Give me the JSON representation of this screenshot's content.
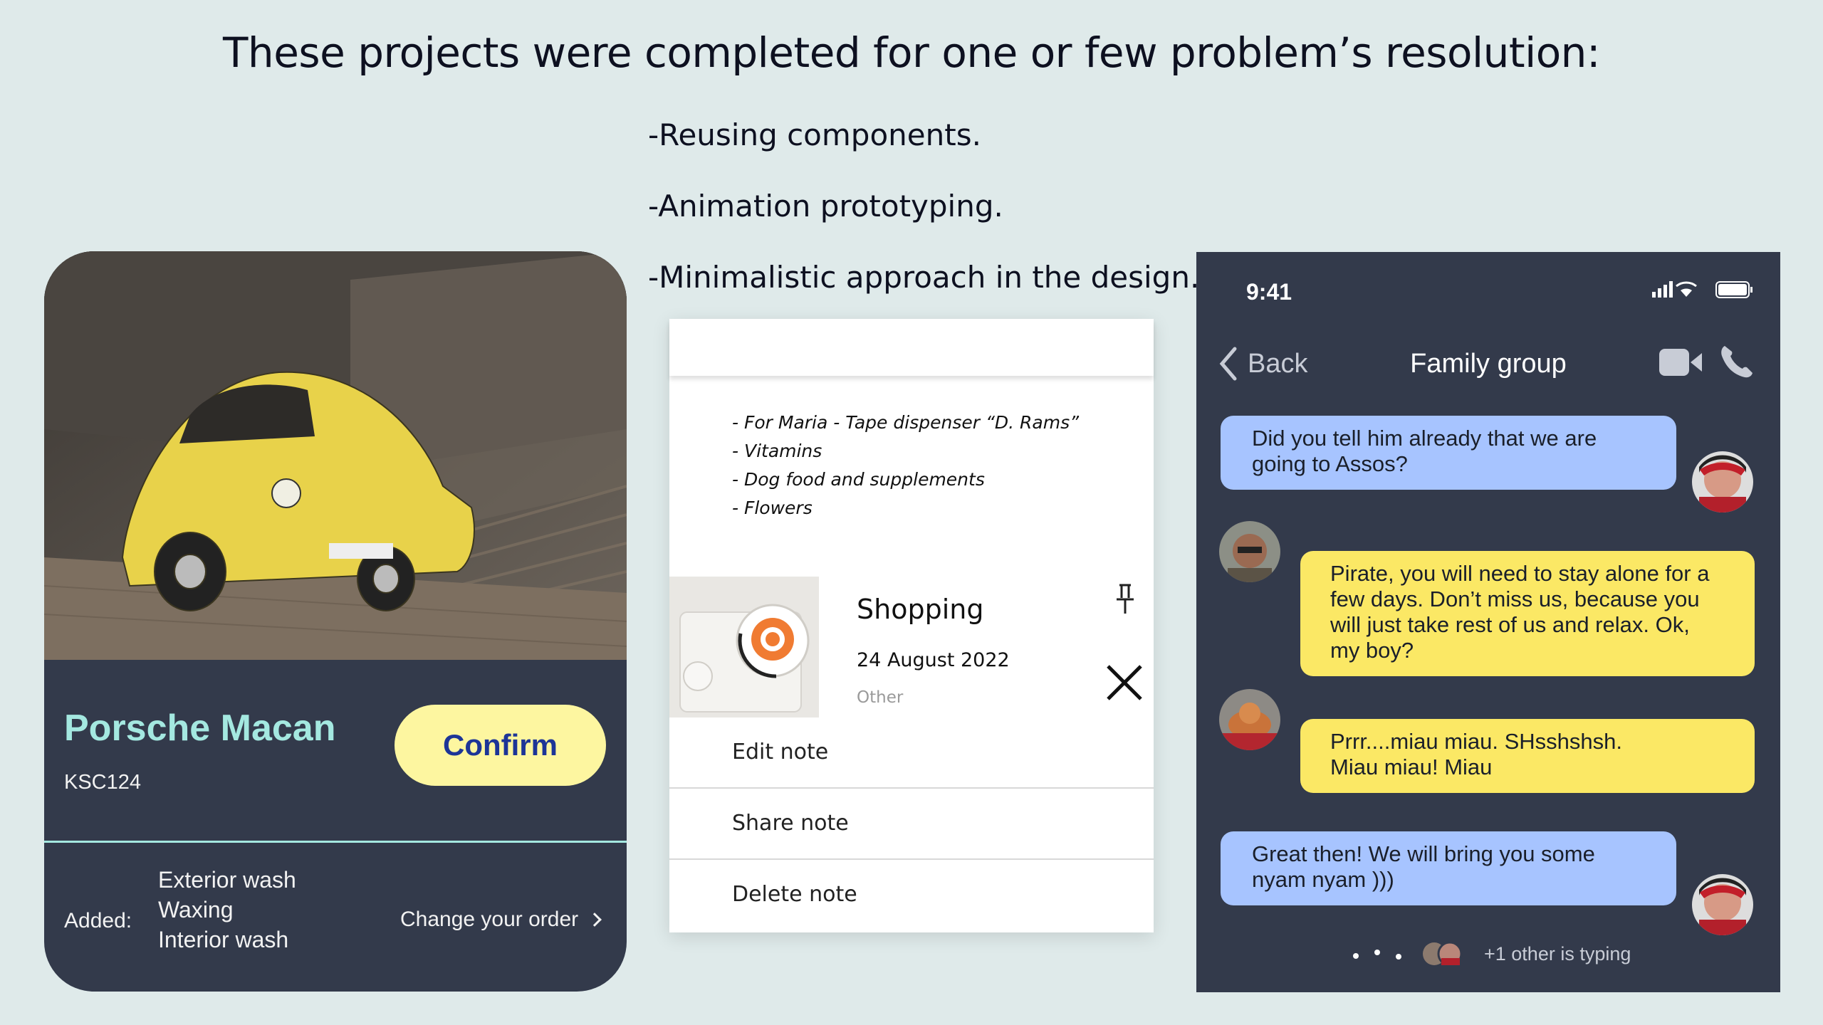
{
  "slide": {
    "title": "These projects were completed for one or few problem’s resolution:",
    "bullets": [
      "-Reusing components.",
      "-Animation prototyping.",
      "-Minimalistic approach in the design."
    ]
  },
  "car_card": {
    "title": "Porsche Macan",
    "plate": "KSC124",
    "confirm_label": "Confirm",
    "added_label": "Added:",
    "added_items": [
      "Exterior wash",
      "Waxing",
      "Interior wash"
    ],
    "change_order_label": "Change your order",
    "photo": "yellow-beetle-car-photo",
    "accent": "#a4e8e0",
    "button_color": "#fdf6a0"
  },
  "notes_card": {
    "lines": [
      "- For Maria - Tape dispenser “D. Rams”",
      "- Vitamins",
      "- Dog food and supplements",
      "- Flowers"
    ],
    "note": {
      "title": "Shopping",
      "date": "24 August 2022",
      "category": "Other"
    },
    "menu": [
      "Edit note",
      "Share note",
      "Delete note"
    ]
  },
  "chat": {
    "time": "9:41",
    "back_label": "Back",
    "title": "Family group",
    "messages": [
      {
        "side": "left",
        "color": "blue",
        "text_lines": [
          "Did you tell him already that we are",
          "going to Assos?"
        ]
      },
      {
        "side": "right",
        "color": "yellow",
        "text_lines": [
          "Pirate, you will need to stay alone for a",
          "few days. Don’t miss us, because you",
          "will just take rest of us and relax. Ok,",
          "my boy?"
        ]
      },
      {
        "side": "right",
        "color": "yellow",
        "text_lines": [
          "Prrr....miau miau. SHsshshsh.",
          "Miau miau! Miau"
        ]
      },
      {
        "side": "left",
        "color": "blue",
        "text_lines": [
          "Great then! We will bring you some",
          "nyam nyam )))"
        ]
      }
    ],
    "typing_text": "+1 other is typing",
    "bubble_blue": "#a7c4ff",
    "bubble_yellow": "#fbe865"
  }
}
